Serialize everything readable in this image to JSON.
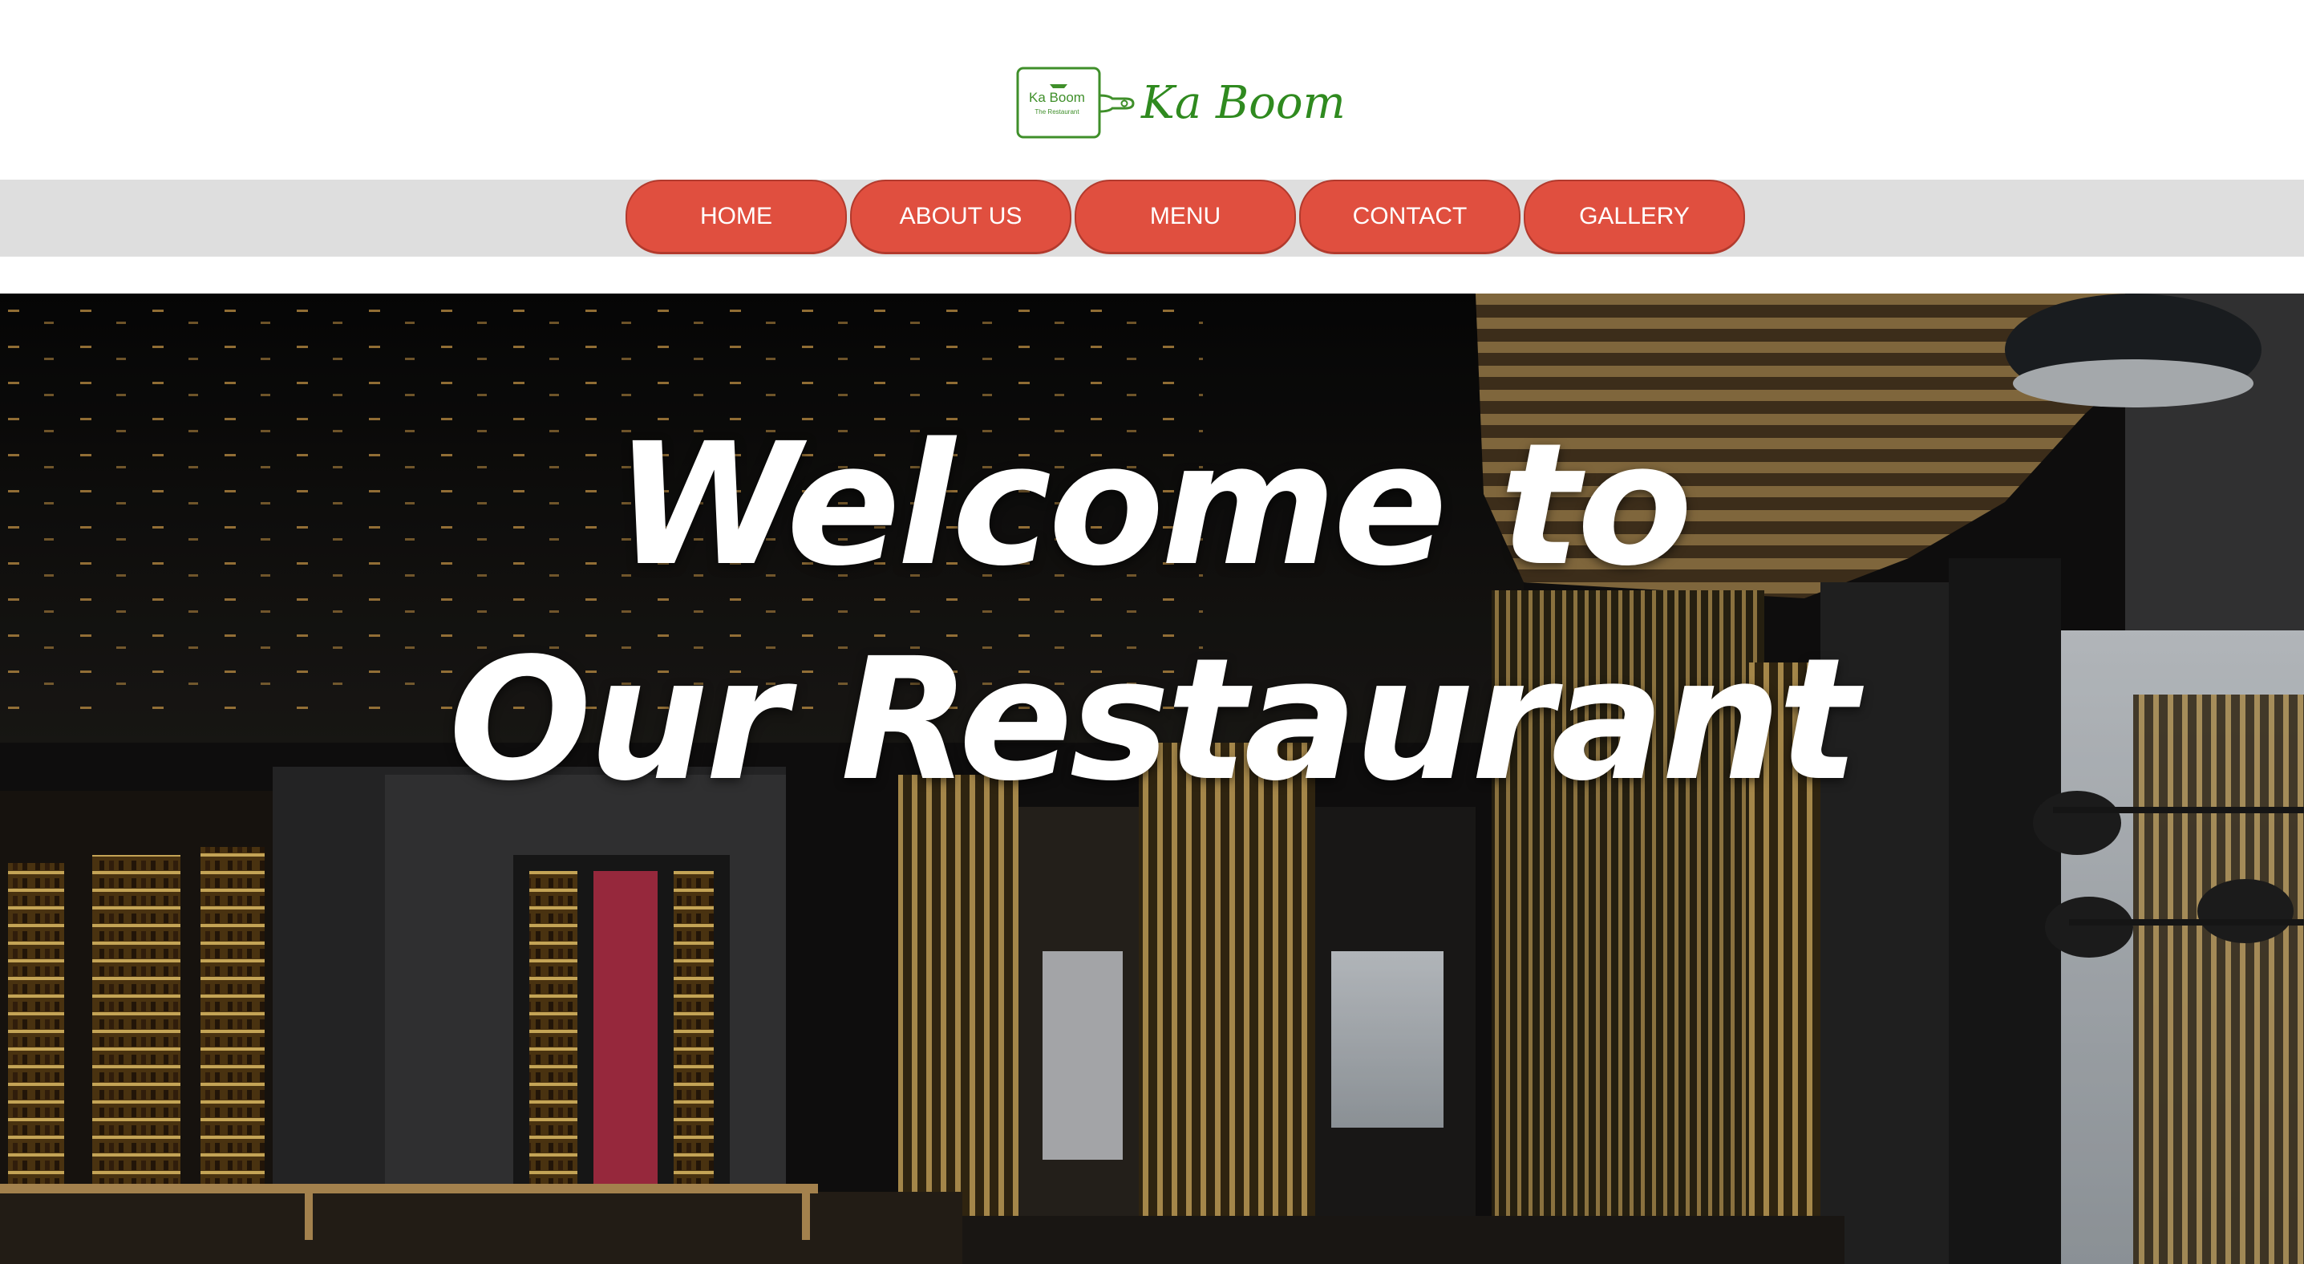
{
  "brand": {
    "board_text": "Ka Boom",
    "board_subtext": "The Restaurant",
    "name": "Ka Boom",
    "color": "#2f8a1f"
  },
  "nav": {
    "items": [
      {
        "label": "HOME"
      },
      {
        "label": "ABOUT US"
      },
      {
        "label": "MENU"
      },
      {
        "label": "CONTACT"
      },
      {
        "label": "GALLERY"
      }
    ],
    "button_color": "#e04f3f",
    "bar_color": "#dedede"
  },
  "hero": {
    "title_line1": "Welcome to",
    "title_line2": "Our Restaurant",
    "image_description_icon": "restaurant-interior-photo"
  }
}
